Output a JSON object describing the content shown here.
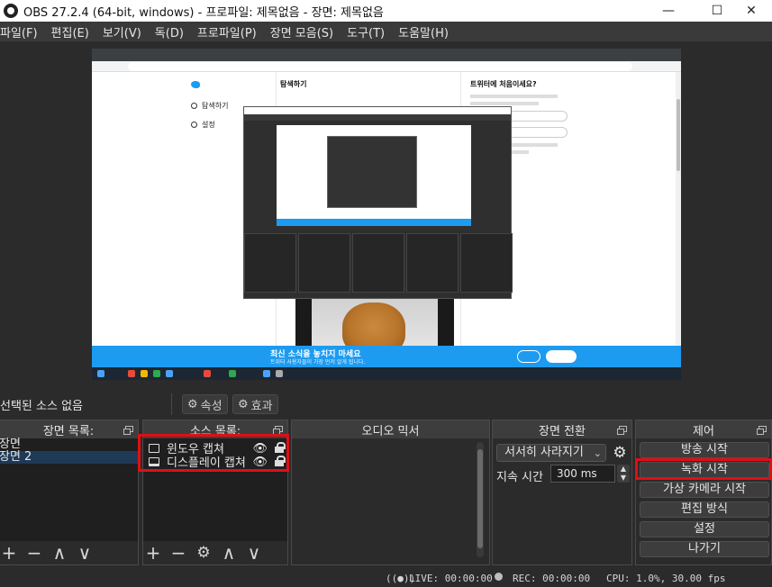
{
  "window": {
    "title": "OBS 27.2.4 (64-bit, windows) - 프로파일: 제목없음 - 장면: 제목없음",
    "controls": {
      "minimize": "—",
      "maximize": "☐",
      "close": "✕"
    }
  },
  "menu": [
    "파일(F)",
    "편집(E)",
    "보기(V)",
    "독(D)",
    "프로파일(P)",
    "장면 모음(S)",
    "도구(T)",
    "도움말(H)"
  ],
  "preview": {
    "browser": {
      "nav_items": [
        "탐색하기",
        "설정"
      ],
      "center_heading": "탐색하기",
      "right_heading": "트위터에 처음이세요?",
      "banner_title": "최신 소식을 놓치지 마세요",
      "banner_subtitle": "트위터 사용자들이 가장 먼저 알게 됩니다."
    }
  },
  "context_bar": {
    "label": "선택된 소스 없음",
    "properties": "속성",
    "filters": "효과"
  },
  "scenes": {
    "title": "장면 목록:",
    "items": [
      {
        "label": "장면",
        "selected": false
      },
      {
        "label": "장면 2",
        "selected": true
      }
    ],
    "tools": {
      "add": "+",
      "remove": "−",
      "up": "∧",
      "down": "∨"
    }
  },
  "sources": {
    "title": "소스 목록:",
    "items": [
      {
        "label": "윈도우 캡쳐",
        "icon": "window-capture-icon"
      },
      {
        "label": "디스플레이 캡쳐",
        "icon": "display-capture-icon"
      }
    ],
    "tools": {
      "add": "+",
      "remove": "−",
      "settings": "⚙",
      "up": "∧",
      "down": "∨"
    }
  },
  "mixer": {
    "title": "오디오 믹서"
  },
  "transitions": {
    "title": "장면 전환",
    "selected": "서서히 사라지기",
    "duration_label": "지속 시간",
    "duration_value": "300 ms"
  },
  "controls": {
    "title": "제어",
    "buttons": [
      "방송 시작",
      "녹화 시작",
      "가상 카메라 시작",
      "편집 방식",
      "설정",
      "나가기"
    ]
  },
  "status": {
    "live": "LIVE: 00:00:00",
    "rec": "REC: 00:00:00",
    "cpu": "CPU: 1.0%, 30.00 fps"
  },
  "colors": {
    "highlight": "#e10e16",
    "selection": "#1f3a57",
    "twitter_blue": "#1d9bf0"
  }
}
